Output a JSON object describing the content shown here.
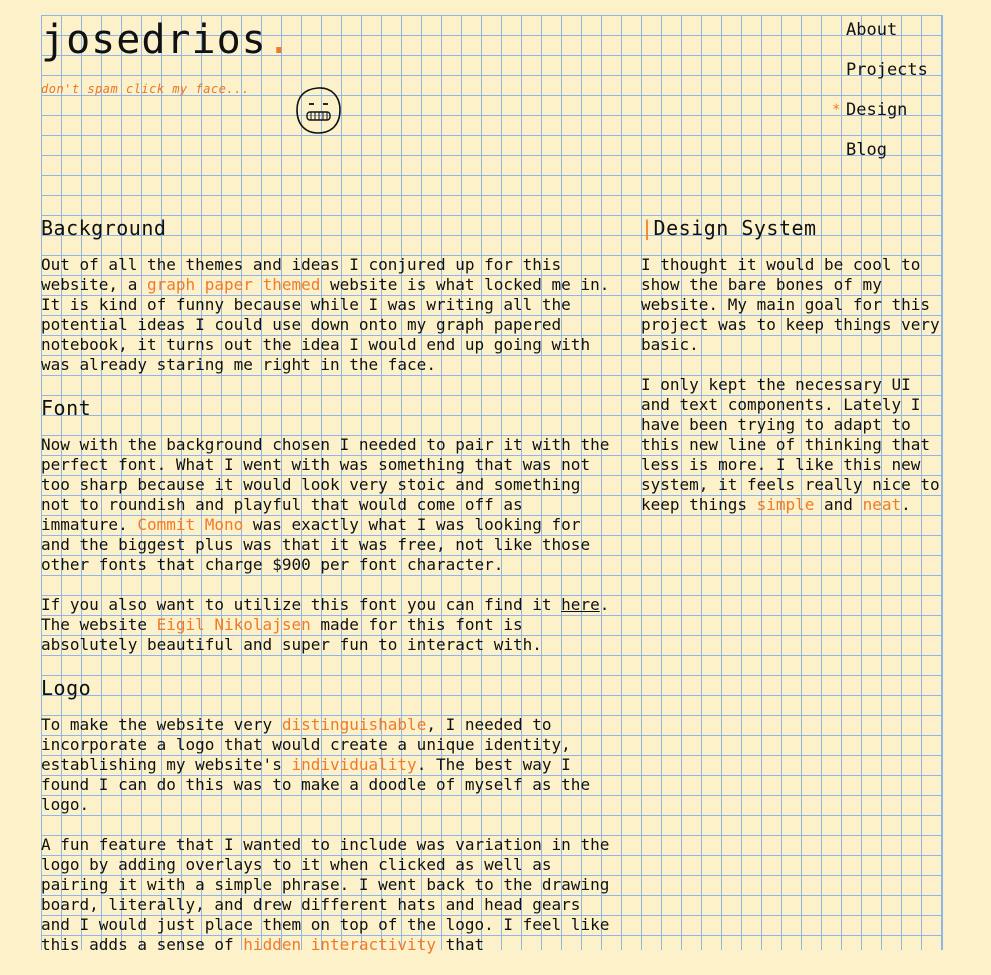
{
  "header": {
    "logo_text": "josedrios",
    "logo_dot": ".",
    "tagline": "don't spam click my face..."
  },
  "nav": {
    "items": [
      {
        "label": "About",
        "active": false
      },
      {
        "label": "Projects",
        "active": false
      },
      {
        "label": "Design",
        "active": true
      },
      {
        "label": "Blog",
        "active": false
      }
    ],
    "active_marker": "*"
  },
  "colors": {
    "background": "#fcf1c8",
    "grid": "#8fb6e6",
    "accent": "#f07a2a",
    "text": "#111111"
  },
  "main": {
    "background": {
      "heading": "Background",
      "p1_a": "Out of all the themes and ideas I conjured up for this website, a ",
      "p1_link": "graph paper themed",
      "p1_b": " website is what locked me in. It is kind of funny because while I was writing all the potential ideas I could use down onto my graph papered notebook, it turns out the idea I would end up going with was already staring me right in the face."
    },
    "font": {
      "heading": "Font",
      "p1_a": "Now with the background chosen I needed to pair it with the perfect font. What I went with was something that was not too sharp because it would look very stoic and something not to roundish and playful that would come off as immature. ",
      "p1_link": "Commit Mono",
      "p1_b": " was exactly what I was looking for and the biggest plus was that it was free, not like those other fonts that charge $900 per font character.",
      "p2_a": "If you also want to utilize this font you can find it ",
      "p2_link1": "here",
      "p2_b": ". The website ",
      "p2_link2": "Eigil Nikolajsen",
      "p2_c": " made for this font is absolutely beautiful and super fun to interact with."
    },
    "logo": {
      "heading": "Logo",
      "p1_a": "To make the website very ",
      "p1_link1": "distinguishable",
      "p1_b": ", I needed to incorporate a logo that would create a unique identity, establishing my website's ",
      "p1_link2": "individuality",
      "p1_c": ". The best way I found I can do this was to make a doodle of myself as the logo.",
      "p2_a": "A fun feature that I wanted to include was variation in the logo by adding overlays to it when clicked as well as pairing it with a simple phrase. I went back to the drawing board, literally, and drew different hats and head gears and I would just place them on top of the logo. I feel like this adds a sense of ",
      "p2_link": "hidden interactivity",
      "p2_b": " that"
    }
  },
  "aside": {
    "heading_marker": "|",
    "heading": "Design System",
    "p1": "I thought it would be cool to show the bare bones of my website. My main goal for this project was to keep things very basic.",
    "p2_a": "I only kept the necessary UI and text components. Lately I have been trying to adapt to this new line of thinking that less is more. I like this new system, it feels really nice to keep things ",
    "p2_link1": "simple",
    "p2_b": " and ",
    "p2_link2": "neat",
    "p2_c": "."
  }
}
